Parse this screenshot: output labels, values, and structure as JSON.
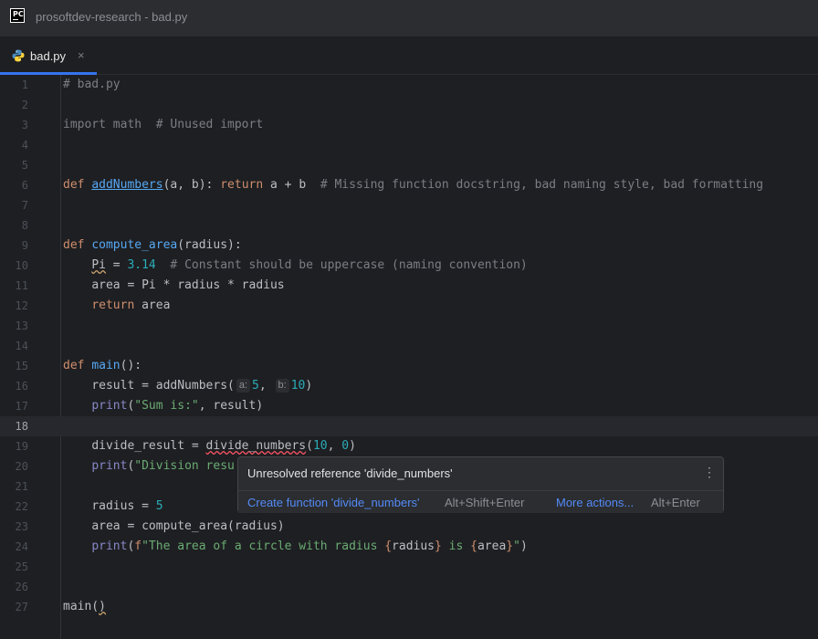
{
  "window": {
    "title": "prosoftdev-research - bad.py",
    "logo_text": "PC",
    "accent_color": "#3574f0"
  },
  "tabs": [
    {
      "label": "bad.py",
      "icon": "python-icon",
      "close": "×"
    }
  ],
  "editor": {
    "line_numbers": [
      "1",
      "2",
      "3",
      "4",
      "5",
      "6",
      "7",
      "8",
      "9",
      "10",
      "11",
      "12",
      "13",
      "14",
      "15",
      "16",
      "17",
      "18",
      "19",
      "20",
      "21",
      "22",
      "23",
      "24",
      "25",
      "26",
      "27"
    ],
    "current_line": "18",
    "code": {
      "l1": "# bad.py",
      "l3_kw": "import",
      "l3_mod": " math  ",
      "l3_cmt": "# Unused import",
      "l6_def": "def ",
      "l6_fn": "addNumbers",
      "l6_params": "(a, b): ",
      "l6_ret": "return",
      "l6_expr": " a + b  ",
      "l6_cmt": "# Missing function docstring, bad naming style, bad formatting",
      "l9_def": "def ",
      "l9_fn": "compute_area",
      "l9_params": "(radius):",
      "l10_var": "Pi",
      "l10_eq": " = ",
      "l10_num": "3.14",
      "l10_sp": "  ",
      "l10_cmt": "# Constant should be uppercase (naming convention)",
      "l11": "area = Pi * radius * radius",
      "l12_ret": "return",
      "l12_rest": " area",
      "l15_def": "def ",
      "l15_fn": "main",
      "l15_params": "():",
      "l16_a": "result = addNumbers(",
      "l16_hint_a": "a:",
      "l16_n1": "5",
      "l16_comma": ",",
      "l16_hint_b": "b:",
      "l16_n2": "10",
      "l16_close": ")",
      "l17_print": "print",
      "l17_open": "(",
      "l17_str": "\"Sum is:\"",
      "l17_rest": ", result)",
      "l19_a": "divide_result = ",
      "l19_fn": "divide_numbers",
      "l19_open": "(",
      "l19_n1": "10",
      "l19_comma": ", ",
      "l19_n2": "0",
      "l19_close": ")",
      "l20_print": "print",
      "l20_open": "(",
      "l20_str": "\"Division resu",
      "l22_a": "radius = ",
      "l22_num": "5",
      "l23": "area = compute_area(radius)",
      "l24_print": "print",
      "l24_open": "(",
      "l24_f": "f",
      "l24_s1": "\"The area of a circle with radius ",
      "l24_b1": "{",
      "l24_v1": "radius",
      "l24_b2": "}",
      "l24_s2": " is ",
      "l24_b3": "{",
      "l24_v2": "area",
      "l24_b4": "}",
      "l24_s3": "\"",
      "l24_close": ")",
      "l27_a": "main(",
      "l27_b": ")"
    }
  },
  "popup": {
    "message": "Unresolved reference 'divide_numbers'",
    "more_icon": "⋮",
    "action_create": "Create function 'divide_numbers'",
    "action_create_shortcut": "Alt+Shift+Enter",
    "action_more": "More actions...",
    "action_more_shortcut": "Alt+Enter"
  }
}
